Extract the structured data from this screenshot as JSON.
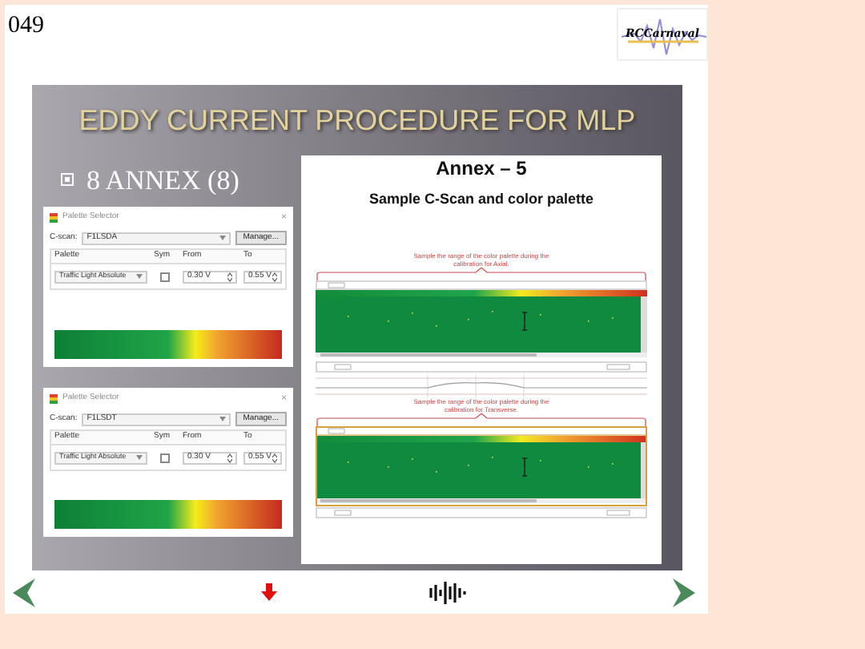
{
  "page_number": "049",
  "logo": {
    "text": "RCCarnaval"
  },
  "slide": {
    "title": "EDDY CURRENT PROCEDURE FOR MLP",
    "heading": "8 ANNEX (8)",
    "dialogs": [
      {
        "title": "Palette Selector",
        "close": "×",
        "cscan_label": "C-scan:",
        "cscan_value": "F1LSDA",
        "manage": "Manage...",
        "columns": [
          "Palette",
          "Sym",
          "From",
          "To"
        ],
        "palette": "Traffic Light Absolute",
        "sym_checked": false,
        "from": "0.30 V",
        "to": "0.55 V"
      },
      {
        "title": "Palette Selector",
        "close": "×",
        "cscan_label": "C-scan:",
        "cscan_value": "F1LSDT",
        "manage": "Manage...",
        "columns": [
          "Palette",
          "Sym",
          "From",
          "To"
        ],
        "palette": "Traffic Light Absolute",
        "sym_checked": false,
        "from": "0.30 V",
        "to": "0.55 V"
      }
    ],
    "annex": {
      "title": "Annex – 5",
      "subtitle": "Sample C-Scan and color palette",
      "scans": [
        {
          "note": "Sample the range of the color palette during the calibration for Axial.",
          "framed": false
        },
        {
          "note": "Sample the range of the color palette during the calibration for Transverse.",
          "framed": true
        }
      ]
    }
  }
}
